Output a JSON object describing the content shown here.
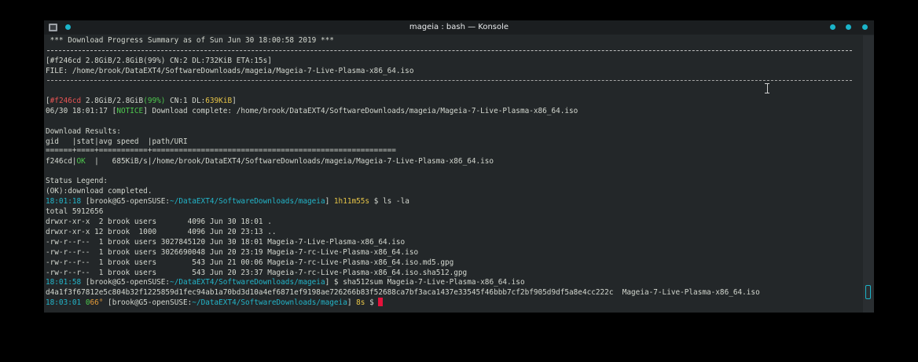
{
  "window": {
    "title": "mageia : bash — Konsole",
    "accent_color": "#1bb4c9",
    "icons": [
      "app-menu-icon",
      "pin-icon",
      "minimize-icon",
      "maximize-icon",
      "close-icon"
    ]
  },
  "terminal": {
    "summary_header": " *** Download Progress Summary as of Sun Jun 30 18:00:58 2019 ***",
    "progress1": "[#f246cd 2.8GiB/2.8GiB(99%) CN:2 DL:732KiB ETA:15s]",
    "file_line": "FILE: /home/brook/DataEXT4/SoftwareDownloads/mageia/Mageia-7-Live-Plasma-x86_64.iso",
    "progress2": {
      "open": "[",
      "gid": "#f246cd",
      "size": " 2.8GiB/2.8GiB",
      "pct": "(99%)",
      "cn": " CN:1 DL:",
      "dl": "639KiB",
      "close": "]"
    },
    "notice": {
      "time": "06/30 18:01:17 [",
      "tag": "NOTICE",
      "msg": "] Download complete: /home/brook/DataEXT4/SoftwareDownloads/mageia/Mageia-7-Live-Plasma-x86_64.iso"
    },
    "results_title": "Download Results:",
    "results_header": "gid   |stat|avg speed  |path/URI",
    "results_rule": "======+====+===========+=======================================================",
    "result_row": {
      "gid": "f246cd|",
      "stat": "OK",
      "rest": "  |   685KiB/s|/home/brook/DataEXT4/SoftwareDownloads/mageia/Mageia-7-Live-Plasma-x86_64.iso"
    },
    "legend_title": "Status Legend:",
    "legend_ok": "(OK):download completed.",
    "prompt1": {
      "time": "18:01:18",
      "user": " [brook@G5-openSUSE:",
      "path": "~/DataEXT4/SoftwareDownloads/mageia",
      "close": "] ",
      "elapsed": "1h11m55s",
      "dollar": " $ ",
      "cmd": "ls -la"
    },
    "ls_total": "total 5912656",
    "ls_rows": [
      "drwxr-xr-x  2 brook users       4096 Jun 30 18:01 .",
      "drwxr-xr-x 12 brook  1000       4096 Jun 20 23:13 ..",
      "-rw-r--r--  1 brook users 3027845120 Jun 30 18:01 Mageia-7-Live-Plasma-x86_64.iso",
      "-rw-r--r--  1 brook users 3026690048 Jun 20 23:19 Mageia-7-rc-Live-Plasma-x86_64.iso",
      "-rw-r--r--  1 brook users        543 Jun 21 00:06 Mageia-7-rc-Live-Plasma-x86_64.iso.md5.gpg",
      "-rw-r--r--  1 brook users        543 Jun 20 23:37 Mageia-7-rc-Live-Plasma-x86_64.iso.sha512.gpg"
    ],
    "prompt2": {
      "time": "18:01:58",
      "user": " [brook@G5-openSUSE:",
      "path": "~/DataEXT4/SoftwareDownloads/mageia",
      "close": "] $ ",
      "cmd": "sha512sum Mageia-7-Live-Plasma-x86_64.iso"
    },
    "sha_output": "d4a1f3f67812e5c804b32f1225859d1fec94ab1a70bd3d10a4ef6871ef9198ae726266b83f52688ca7bf3aca1437e33545f46bbb7cf2bf905d9df5a8e4cc222c  Mageia-7-Live-Plasma-x86_64.iso",
    "prompt3": {
      "time": "18:03:01",
      "space": " ",
      "rc": "0",
      "temp": "66°",
      "user": " [brook@G5-openSUSE:",
      "path": "~/DataEXT4/SoftwareDownloads/mageia",
      "close": "] ",
      "elapsed": "8s",
      "dollar": " $ "
    }
  }
}
